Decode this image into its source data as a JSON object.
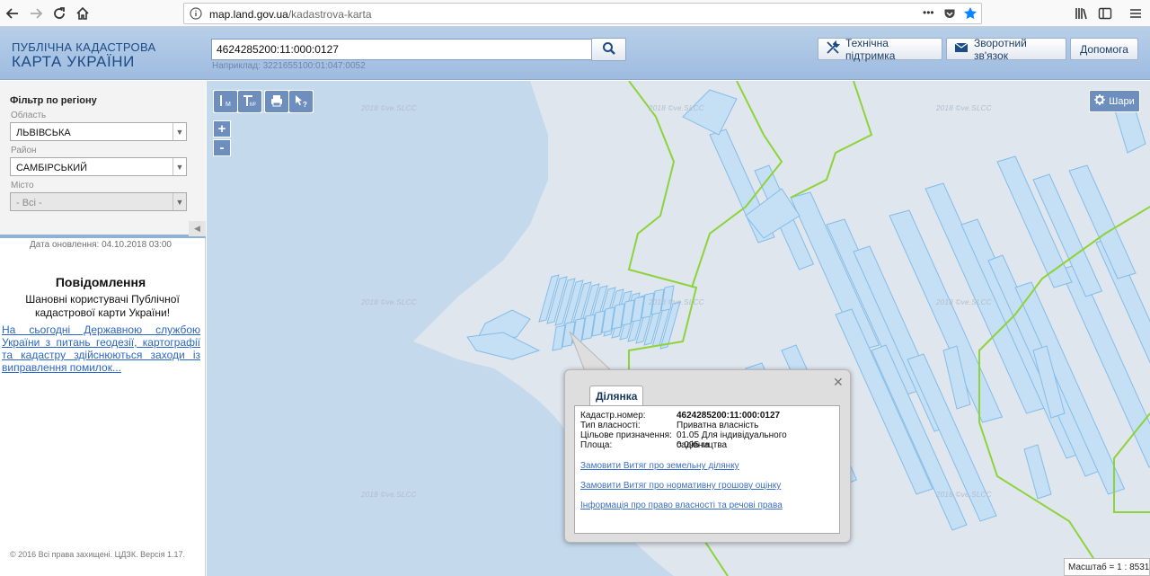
{
  "browser": {
    "url_host": "map.land.gov.ua",
    "url_path": "/kadastrova-karta",
    "more_label": "•••"
  },
  "header": {
    "logo_line1": "ПУБЛІЧНА КАДАСТРОВА",
    "logo_line2": "КАРТА УКРАЇНИ",
    "search_value": "4624285200:11:000:0127",
    "search_hint": "Наприклад: 3221655100:01:047:0052",
    "support_label": "Технічна підтримка",
    "feedback_label": "Зворотний зв'язок",
    "help_label": "Допомога"
  },
  "sidebar": {
    "filter_title": "Фільтр по регіону",
    "oblast_label": "Область",
    "oblast_value": "ЛЬВІВСЬКА",
    "raion_label": "Район",
    "raion_value": "САМБІРСЬКИЙ",
    "misto_label": "Місто",
    "misto_value": "- Всі -",
    "update_date": "Дата оновлення: 04.10.2018 03:00",
    "notice_title": "Повідомлення",
    "notice_text": "Шановні користувачі Публічної кадастрової карти України!",
    "notice_link": "На сьогодні Державною службою України з питань геодезії, картографії та кадастру здійснюються заходи із виправлення помилок...",
    "copyright": "© 2016 Всі права захищені. ЦДЗК. Версія 1.17."
  },
  "map": {
    "layers_label": "Шари",
    "scale_text": "Масштаб = 1 : 8531",
    "watermark": "2018 ©vе.SLCC",
    "colors": {
      "water": "#c5d9ed",
      "land": "#dfe6ee",
      "parcel_fill": "#c5dff5",
      "parcel_stroke": "#84bde8",
      "boundary": "#8dd33a"
    }
  },
  "popup": {
    "tab_label": "Ділянка",
    "rows": [
      {
        "label": "Кадастр.номер:",
        "value": "4624285200:11:000:0127",
        "bold": true
      },
      {
        "label": "Тип власності:",
        "value": "Приватна власність",
        "bold": false
      },
      {
        "label": "Цільове призначення:",
        "value": "01.05 Для індивідуального садівництва",
        "bold": false
      },
      {
        "label": "Площа:",
        "value": "0.095 га",
        "bold": false
      }
    ],
    "links": [
      "Замовити Витяг про земельну ділянку",
      "Замовити Витяг про нормативну грошову оцінку",
      "Інформація про право власності та речові права"
    ]
  }
}
